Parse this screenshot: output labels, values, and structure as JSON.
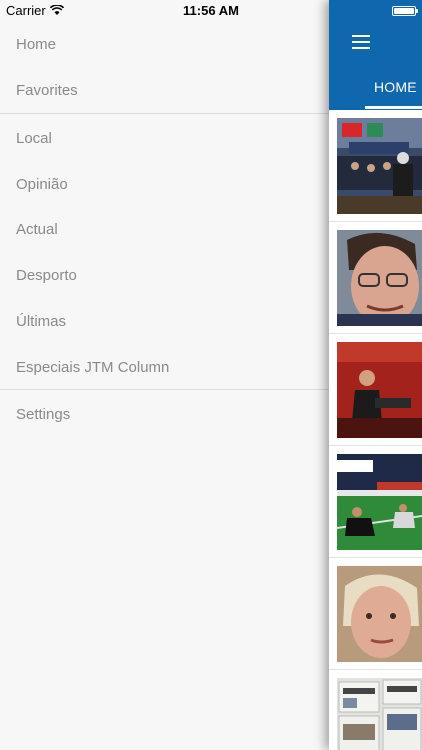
{
  "status_bar": {
    "carrier": "Carrier",
    "time": "11:56 AM"
  },
  "drawer": {
    "items": [
      {
        "label": "Home"
      },
      {
        "label": "Favorites"
      },
      {
        "label": "Local"
      },
      {
        "label": "Opinião"
      },
      {
        "label": "Actual"
      },
      {
        "label": "Desporto"
      },
      {
        "label": "Últimas"
      },
      {
        "label": "Especiais JTM Column"
      },
      {
        "label": "Settings"
      }
    ]
  },
  "main": {
    "tab_label": "HOME",
    "accent_color": "#0f68ad",
    "thumbnails": [
      {
        "icon": "ceremony-photo-thumbnail"
      },
      {
        "icon": "portrait-glasses-photo-thumbnail"
      },
      {
        "icon": "speaker-red-stage-photo-thumbnail"
      },
      {
        "icon": "football-match-photo-thumbnail"
      },
      {
        "icon": "portrait-woman-photo-thumbnail"
      },
      {
        "icon": "newspapers-photo-thumbnail"
      }
    ]
  }
}
